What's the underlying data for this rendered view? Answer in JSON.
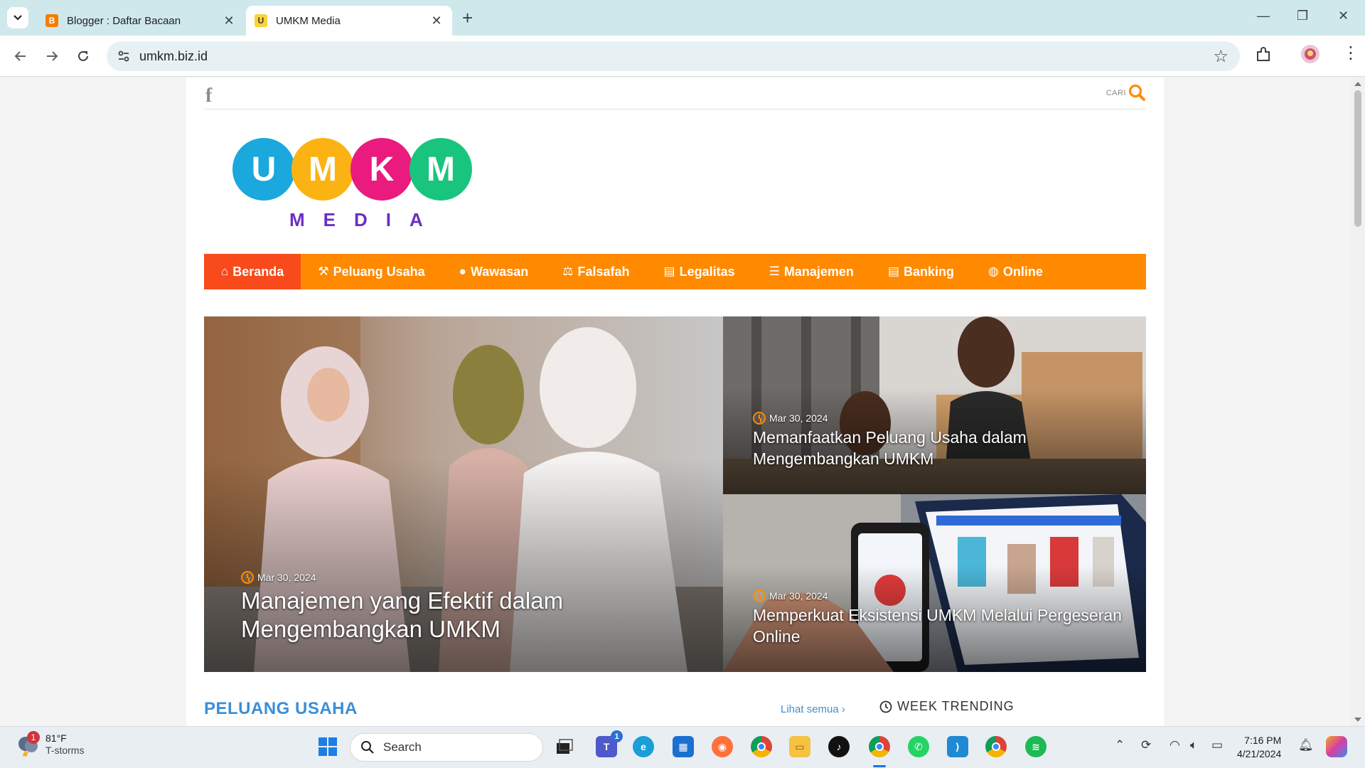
{
  "browser": {
    "tabs": [
      {
        "title": "Blogger : Daftar Bacaan",
        "favicon": "blogger-icon",
        "active": false
      },
      {
        "title": "UMKM Media",
        "favicon": "umkm-favicon",
        "active": true
      }
    ],
    "new_tab": "+",
    "window_controls": {
      "minimize": "—",
      "restore": "❐",
      "close": "✕"
    },
    "url": "umkm.biz.id",
    "icons": [
      "back-icon",
      "forward-icon",
      "reload-icon",
      "site-info-icon",
      "bookmark-star-icon",
      "extensions-icon",
      "profile-avatar",
      "menu-icon"
    ]
  },
  "site": {
    "search_label": "CARI",
    "logo": {
      "letters": [
        "U",
        "M",
        "K",
        "M"
      ],
      "colors": [
        "#1ba8dc",
        "#fbb313",
        "#ea1a7f",
        "#19c57e"
      ],
      "subtitle": "MEDIA",
      "subtitle_color": "#6a2fc5"
    },
    "nav": [
      {
        "label": "Beranda",
        "icon": "home-icon"
      },
      {
        "label": "Peluang Usaha",
        "icon": "worker-icon"
      },
      {
        "label": "Wawasan",
        "icon": "lightbulb-icon"
      },
      {
        "label": "Falsafah",
        "icon": "scale-icon"
      },
      {
        "label": "Legalitas",
        "icon": "document-icon"
      },
      {
        "label": "Manajemen",
        "icon": "list-icon"
      },
      {
        "label": "Banking",
        "icon": "file-icon"
      },
      {
        "label": "Online",
        "icon": "globe-icon"
      }
    ],
    "colors": {
      "nav_bg": "#ff8a00",
      "nav_active": "#f84a1b",
      "accent_blue": "#3a8fd6"
    },
    "featured": {
      "main": {
        "date": "Mar 30, 2024",
        "title": "Manajemen yang Efektif dalam Mengembangkan UMKM"
      },
      "side1": {
        "date": "Mar 30, 2024",
        "title": "Memanfaatkan Peluang Usaha dalam Mengembangkan UMKM"
      },
      "side2": {
        "date": "Mar 30, 2024",
        "title": "Memperkuat Eksistensi UMKM Melalui Pergeseran Online"
      }
    },
    "section_title": "PELUANG USAHA",
    "see_all": "Lihat semua",
    "trending": "WEEK TRENDING"
  },
  "taskbar": {
    "weather": {
      "badge": "1",
      "temp": "81°F",
      "desc": "T-storms"
    },
    "search_placeholder": "Search",
    "teams_badge": "1",
    "time": "7:16 PM",
    "date": "4/21/2024"
  }
}
